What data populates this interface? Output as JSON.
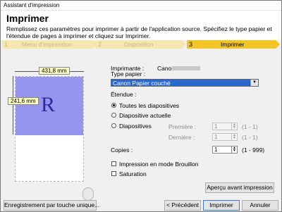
{
  "window": {
    "title": "Assistant d'impression"
  },
  "header": {
    "title": "Imprimer",
    "description": "Remplissez ces paramètres pour imprimer à partir de l'application source. Spécifiez le type papier et l'étendue de pages à imprimer et cliquez sur Imprimer."
  },
  "steps": [
    {
      "num": "1",
      "label": "Menu d'impression"
    },
    {
      "num": "2",
      "label": "Disposition"
    },
    {
      "num": "3",
      "label": "Imprimer"
    }
  ],
  "preview": {
    "width_label": "431,8 mm",
    "height_label": "241,6 mm",
    "letter": "R"
  },
  "printer": {
    "label": "Imprimante :",
    "value": "Canon"
  },
  "paper_type": {
    "label": "Type papier :",
    "value": "Canon Papier couché"
  },
  "range": {
    "label": "Étendue :",
    "options": [
      "Toutes les diapositives",
      "Diapositive actuelle",
      "Diapositives"
    ],
    "selected": "Toutes les diapositives",
    "first_label": "Première :",
    "first_value": "1",
    "first_range": "(1 - 1)",
    "last_label": "Dernière :",
    "last_value": "1",
    "last_range": "(1 - 1)"
  },
  "copies": {
    "label": "Copies :",
    "value": "1",
    "range": "(1 - 999)"
  },
  "options": {
    "draft_label": "Impression en mode Brouillon",
    "saturation_label": "Saturation"
  },
  "buttons": {
    "preview": "Aperçu avant impression",
    "save": "Enregistrement par touche unique...",
    "back": "< Précédent",
    "print": "Imprimer",
    "cancel": "Annuler"
  }
}
